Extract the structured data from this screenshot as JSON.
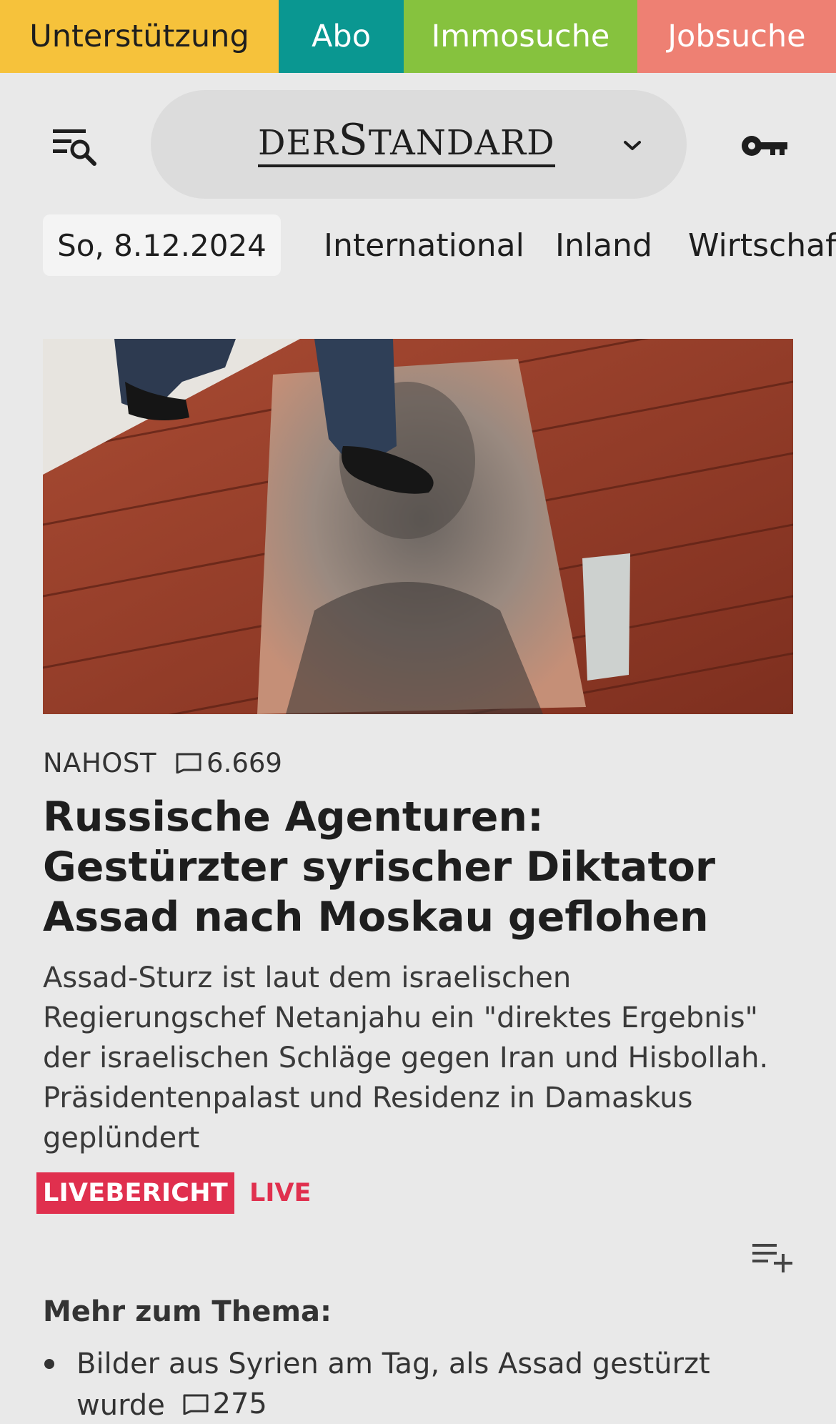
{
  "topbar": {
    "support": "Unterstützung",
    "abo": "Abo",
    "immo": "Immosuche",
    "jobs": "Jobsuche",
    "colors": {
      "support": "#f6c23b",
      "abo": "#0a9791",
      "immo": "#86c23e",
      "jobs": "#ee8073"
    }
  },
  "header": {
    "logo_der": "DER",
    "logo_s": "S",
    "logo_rest": "TANDARD",
    "menu_icon": "menu-search-icon",
    "dropdown_icon": "chevron-down-icon",
    "login_icon": "key-icon"
  },
  "nav": {
    "date": "So, 8.12.2024",
    "items": [
      "International",
      "Inland",
      "Wirtschaft"
    ]
  },
  "article": {
    "kicker": "NAHOST",
    "comments": "6.669",
    "headline": "Russische Agenturen: Gestürzter syrischer Diktator Assad nach Moskau geflohen",
    "teaser": "Assad-Sturz ist laut dem israelischen Regierungschef Netanjahu ein \"direktes Ergebnis\" der israelischen Schläge gegen Iran und Hisbollah. Präsidentenpalast und Residenz in Damaskus geplündert",
    "badge": "LIVEBERICHT",
    "live": "LIVE"
  },
  "more": {
    "title": "Mehr zum Thema:",
    "items": [
      {
        "text": "Bilder aus Syrien am Tag, als Assad gestürzt wurde",
        "comments": "275"
      }
    ]
  }
}
